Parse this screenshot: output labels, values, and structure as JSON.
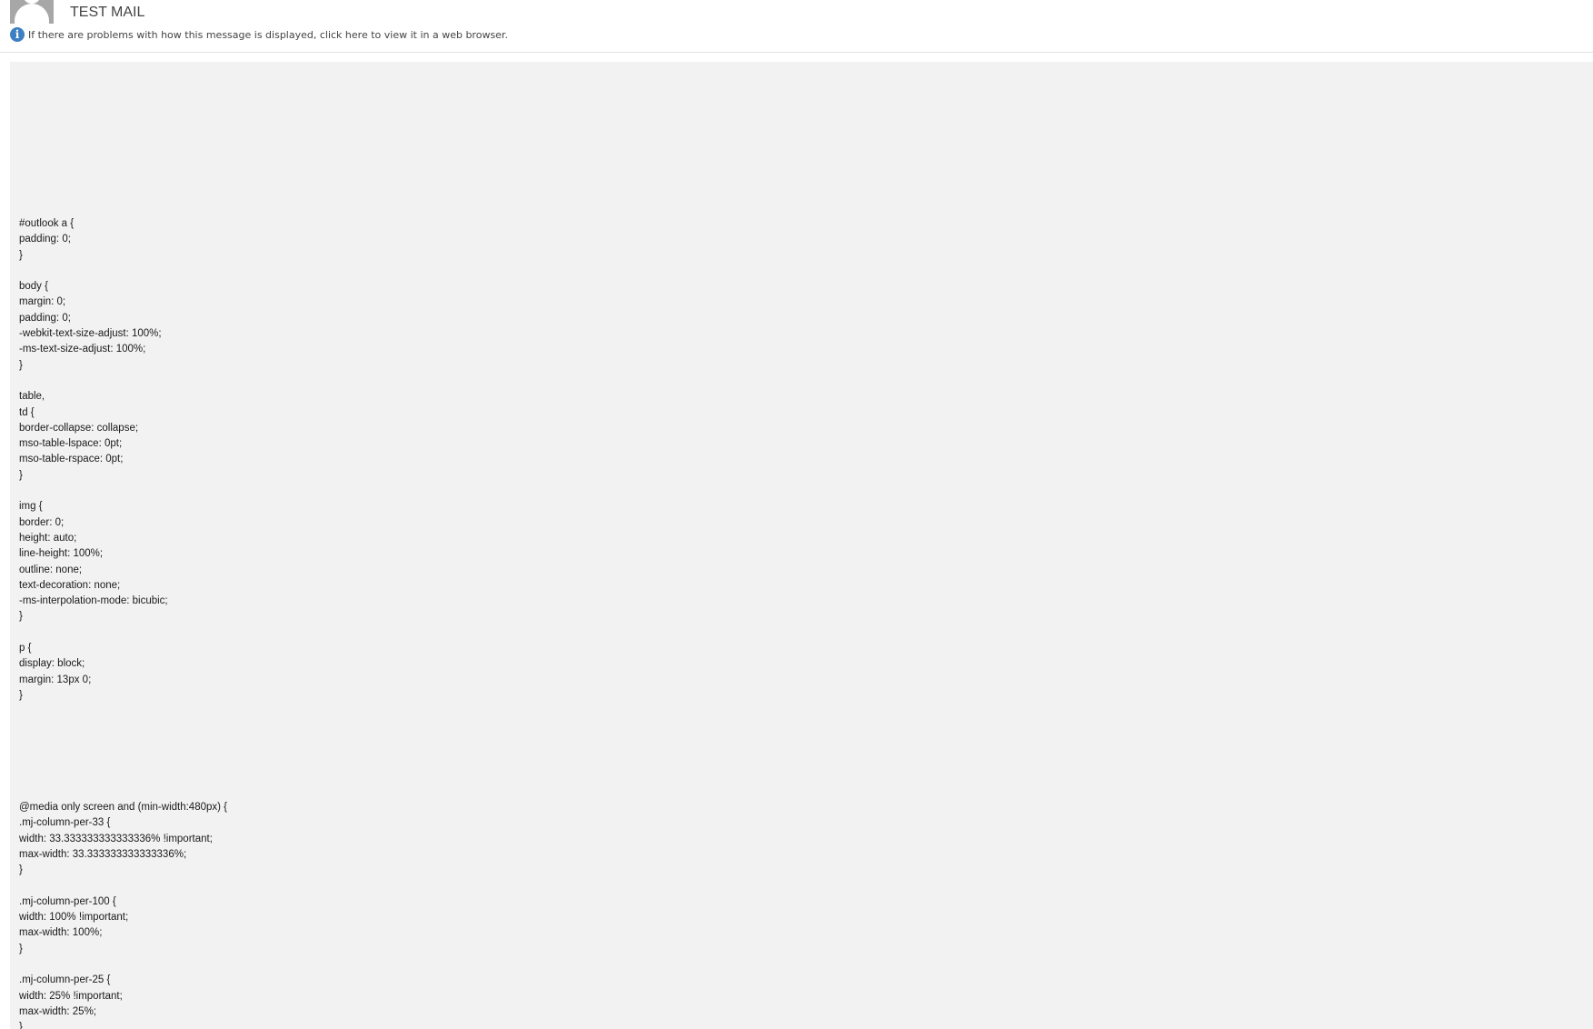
{
  "message": {
    "subject": "TEST MAIL",
    "info_notice": "If there are problems with how this message is displayed, click here to view it in a web browser."
  },
  "body": {
    "css_block_1": "#outlook a {\npadding: 0;\n}\n\nbody {\nmargin: 0;\npadding: 0;\n-webkit-text-size-adjust: 100%;\n-ms-text-size-adjust: 100%;\n}\n\ntable,\ntd {\nborder-collapse: collapse;\nmso-table-lspace: 0pt;\nmso-table-rspace: 0pt;\n}\n\nimg {\nborder: 0;\nheight: auto;\nline-height: 100%;\noutline: none;\ntext-decoration: none;\n-ms-interpolation-mode: bicubic;\n}\n\np {\ndisplay: block;\nmargin: 13px 0;\n}",
    "css_block_2": "@media only screen and (min-width:480px) {\n.mj-column-per-33 {\nwidth: 33.333333333333336% !important;\nmax-width: 33.333333333333336%;\n}\n\n.mj-column-per-100 {\nwidth: 100% !important;\nmax-width: 100%;\n}\n\n.mj-column-per-25 {\nwidth: 25% !important;\nmax-width: 25%;\n}"
  },
  "icons": {
    "avatar": "person-silhouette-icon",
    "info": "info-icon"
  },
  "colors": {
    "body_background": "#f2f2f2",
    "info_icon": "#3c7fc2",
    "avatar": "#a7a7a7"
  }
}
